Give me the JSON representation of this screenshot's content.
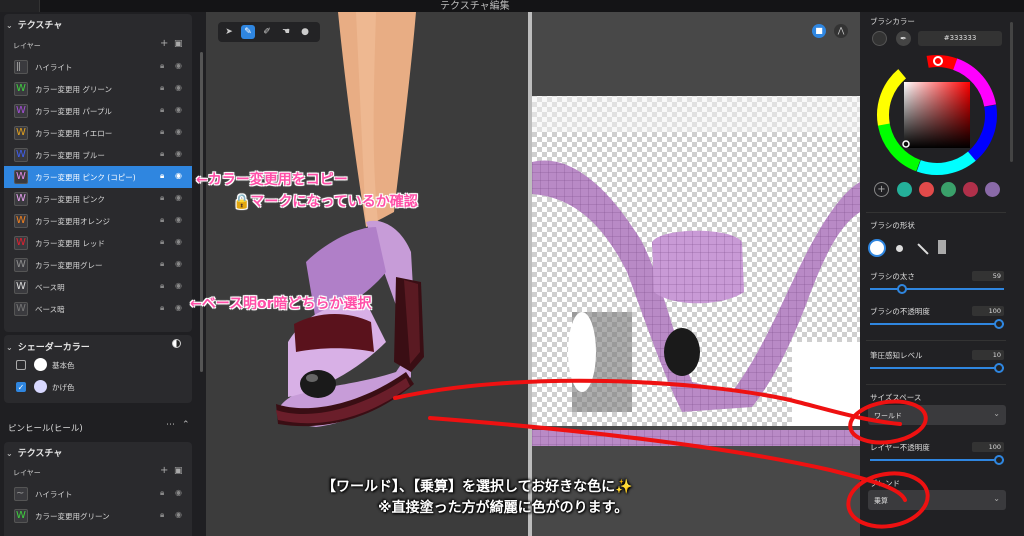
{
  "titlebar": {
    "title": "テクスチャ編集"
  },
  "left_panel": {
    "texture_section": {
      "title": "テクスチャ",
      "layer_label": "レイヤー"
    },
    "layers": [
      {
        "label": "ハイライト",
        "glyph": "ǁ",
        "color": "#999999"
      },
      {
        "label": "カラー変更用 グリーン",
        "glyph": "W",
        "color": "#3fcf3f"
      },
      {
        "label": "カラー変更用 パープル",
        "glyph": "W",
        "color": "#a34fd6"
      },
      {
        "label": "カラー変更用 イエロー",
        "glyph": "W",
        "color": "#e0a020"
      },
      {
        "label": "カラー変更用 ブルー",
        "glyph": "W",
        "color": "#3f5ff0"
      },
      {
        "label": "カラー変更用 ピンク (コピー)",
        "glyph": "W",
        "color": "#e08ae8",
        "selected": true
      },
      {
        "label": "カラー変更用 ピンク",
        "glyph": "W",
        "color": "#e8a0f0"
      },
      {
        "label": "カラー変更用オレンジ",
        "glyph": "W",
        "color": "#f08020"
      },
      {
        "label": "カラー変更用 レッド",
        "glyph": "W",
        "color": "#e02030"
      },
      {
        "label": "カラー変更用グレー",
        "glyph": "W",
        "color": "#909090"
      },
      {
        "label": "ベース明",
        "glyph": "W",
        "color": "#dddddd"
      },
      {
        "label": "ベース暗",
        "glyph": "W",
        "color": "#777777"
      }
    ],
    "shader_section": {
      "title": "シェーダーカラー"
    },
    "shader_items": [
      {
        "label": "基本色",
        "checked": false,
        "color": "#ffffff"
      },
      {
        "label": "かげ色",
        "checked": true,
        "color": "#d8d8ff"
      }
    ],
    "mesh_section": {
      "title": "ピンヒール(ヒール)",
      "more": "⋯"
    },
    "texture_section2": {
      "title": "テクスチャ",
      "layer_label": "レイヤー"
    },
    "layers2": [
      {
        "label": "ハイライト",
        "glyph": "~",
        "color": "#999999"
      },
      {
        "label": "カラー変更用グリーン",
        "glyph": "W",
        "color": "#3fcf3f"
      }
    ]
  },
  "viewport": {
    "tools": [
      "select-tool",
      "brush-tool",
      "eraser-tool",
      "smudge-tool",
      "fill-tool"
    ]
  },
  "right_panel": {
    "brush_color": {
      "title": "ブラシカラー",
      "hex": "#333333"
    },
    "palette": [
      "#24b09a",
      "#e24a4a",
      "#3aa06a",
      "#b0304a",
      "#8a6aa8"
    ],
    "brush_shape": {
      "title": "ブラシの形状"
    },
    "brush_size": {
      "label": "ブラシの太さ",
      "value": "59",
      "fraction": 0.22
    },
    "brush_opacity": {
      "label": "ブラシの不透明度",
      "value": "100",
      "fraction": 1.0
    },
    "pressure": {
      "label": "筆圧感知レベル",
      "value": "10",
      "fraction": 1.0
    },
    "size_space": {
      "label": "サイズスペース",
      "value": "ワールド"
    },
    "layer_opacity": {
      "label": "レイヤー不透明度",
      "value": "100",
      "fraction": 1.0
    },
    "blend": {
      "label": "ブレンド",
      "value": "乗算"
    }
  },
  "annotations": {
    "copy_note": "←カラー変更用をコピー",
    "lock_note": "🔒マークになっているか確認",
    "base_note": "←ベース明or暗どちらか選択",
    "select_note": "【ワールド】、【乗算】を選択してお好きな色に✨",
    "paint_note": "※直接塗った方が綺麗に色がのります。"
  }
}
